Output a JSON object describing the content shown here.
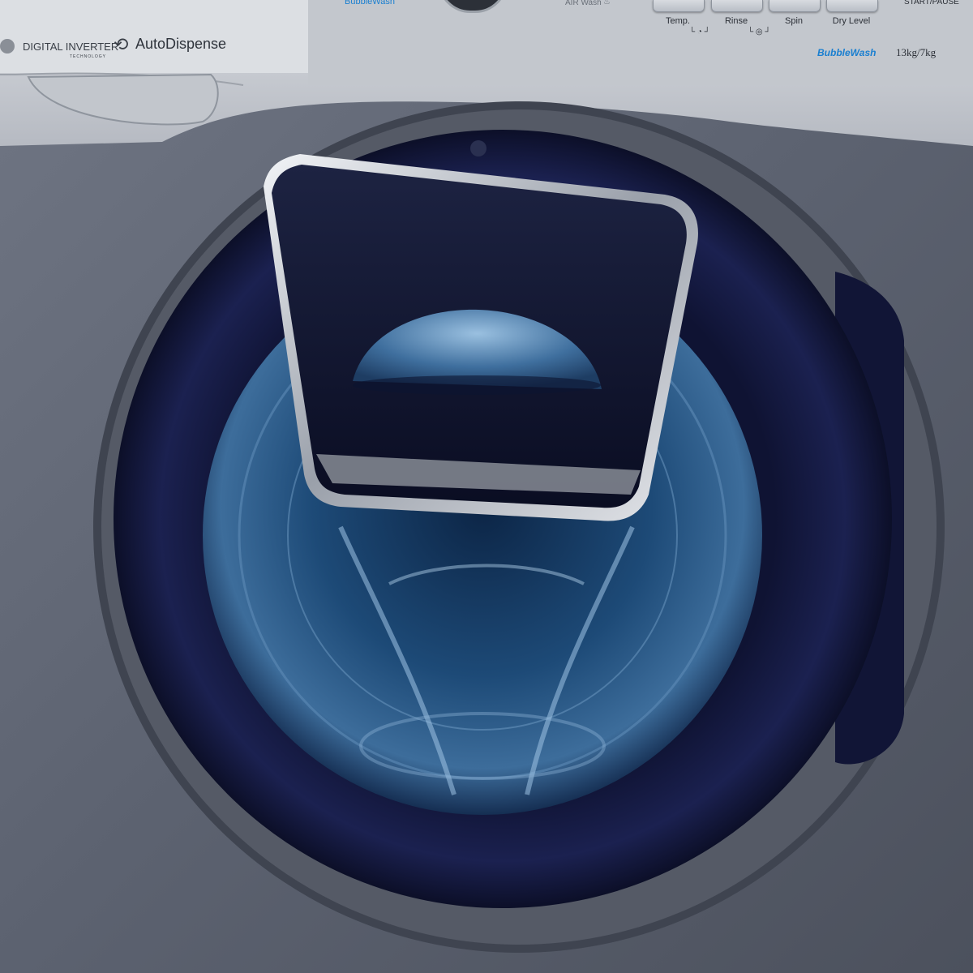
{
  "panel": {
    "top_left_logo": "BubbleWash",
    "air_wash_label": "AIR Wash",
    "start_pause_label": "START/PAUSE",
    "buttons": [
      "Temp.",
      "Rinse",
      "Spin",
      "Dry Level"
    ],
    "digital_inverter": "DIGITAL INVERTER",
    "technology": "TECHNOLOGY",
    "autodispense": "AutoDispense",
    "capacity_brand": "BubbleWash",
    "capacity_text": "13kg/7kg"
  },
  "colors": {
    "body_steel": "#5f6470",
    "control_panel": "#c9ccd1",
    "door_ring": "#151a3b",
    "glass_blue": "#2f5a86",
    "brand_blue": "#1a7fd0"
  },
  "icons": [
    "digital-inverter-logo-icon",
    "autodispense-icon",
    "air-wash-icon",
    "temp-rinse-link-icon",
    "rinse-spin-link-icon"
  ]
}
